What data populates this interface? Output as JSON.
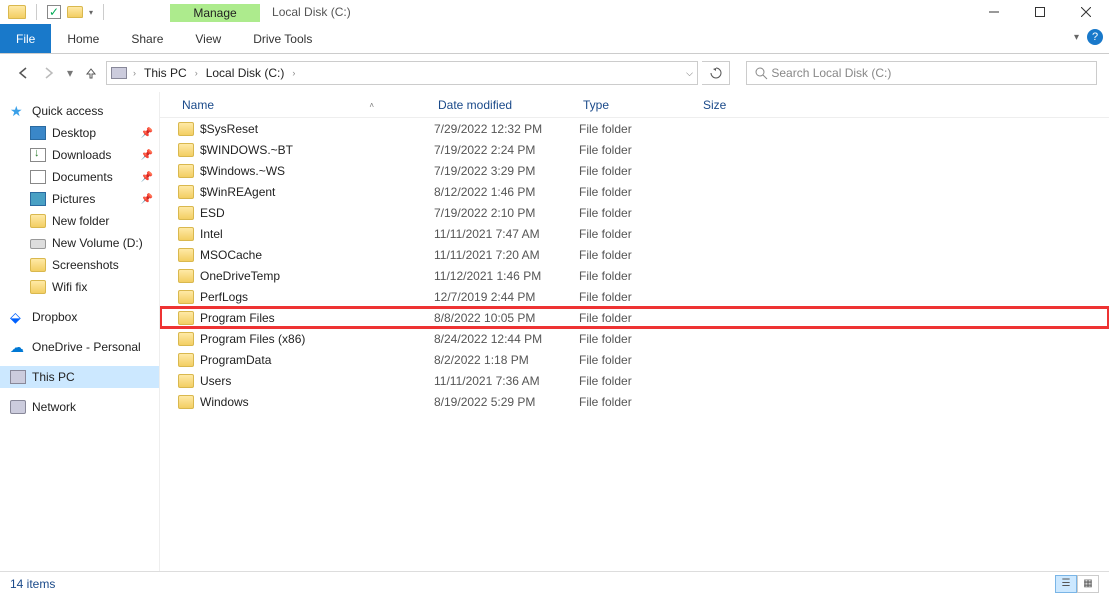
{
  "window": {
    "title": "Local Disk (C:)",
    "manage_tab": "Manage"
  },
  "ribbon": {
    "file": "File",
    "home": "Home",
    "share": "Share",
    "view": "View",
    "drive_tools": "Drive Tools"
  },
  "address": {
    "segments": [
      "This PC",
      "Local Disk (C:)"
    ]
  },
  "search": {
    "placeholder": "Search Local Disk (C:)"
  },
  "sidebar": {
    "quick_access": "Quick access",
    "quick_items": [
      {
        "label": "Desktop",
        "icon": "desktop",
        "pinned": true
      },
      {
        "label": "Downloads",
        "icon": "download",
        "pinned": true
      },
      {
        "label": "Documents",
        "icon": "doc",
        "pinned": true
      },
      {
        "label": "Pictures",
        "icon": "pic",
        "pinned": true
      },
      {
        "label": "New folder",
        "icon": "folder",
        "pinned": false
      },
      {
        "label": "New Volume (D:)",
        "icon": "drive",
        "pinned": false
      },
      {
        "label": "Screenshots",
        "icon": "folder",
        "pinned": false
      },
      {
        "label": "Wifi fix",
        "icon": "folder",
        "pinned": false
      }
    ],
    "dropbox": "Dropbox",
    "onedrive": "OneDrive - Personal",
    "this_pc": "This PC",
    "network": "Network"
  },
  "columns": {
    "name": "Name",
    "date": "Date modified",
    "type": "Type",
    "size": "Size"
  },
  "files": [
    {
      "name": "$SysReset",
      "date": "7/29/2022 12:32 PM",
      "type": "File folder"
    },
    {
      "name": "$WINDOWS.~BT",
      "date": "7/19/2022 2:24 PM",
      "type": "File folder"
    },
    {
      "name": "$Windows.~WS",
      "date": "7/19/2022 3:29 PM",
      "type": "File folder"
    },
    {
      "name": "$WinREAgent",
      "date": "8/12/2022 1:46 PM",
      "type": "File folder"
    },
    {
      "name": "ESD",
      "date": "7/19/2022 2:10 PM",
      "type": "File folder"
    },
    {
      "name": "Intel",
      "date": "11/11/2021 7:47 AM",
      "type": "File folder"
    },
    {
      "name": "MSOCache",
      "date": "11/11/2021 7:20 AM",
      "type": "File folder"
    },
    {
      "name": "OneDriveTemp",
      "date": "11/12/2021 1:46 PM",
      "type": "File folder"
    },
    {
      "name": "PerfLogs",
      "date": "12/7/2019 2:44 PM",
      "type": "File folder"
    },
    {
      "name": "Program Files",
      "date": "8/8/2022 10:05 PM",
      "type": "File folder",
      "highlight": true
    },
    {
      "name": "Program Files (x86)",
      "date": "8/24/2022 12:44 PM",
      "type": "File folder"
    },
    {
      "name": "ProgramData",
      "date": "8/2/2022 1:18 PM",
      "type": "File folder"
    },
    {
      "name": "Users",
      "date": "11/11/2021 7:36 AM",
      "type": "File folder"
    },
    {
      "name": "Windows",
      "date": "8/19/2022 5:29 PM",
      "type": "File folder"
    }
  ],
  "status": {
    "count": "14 items"
  }
}
